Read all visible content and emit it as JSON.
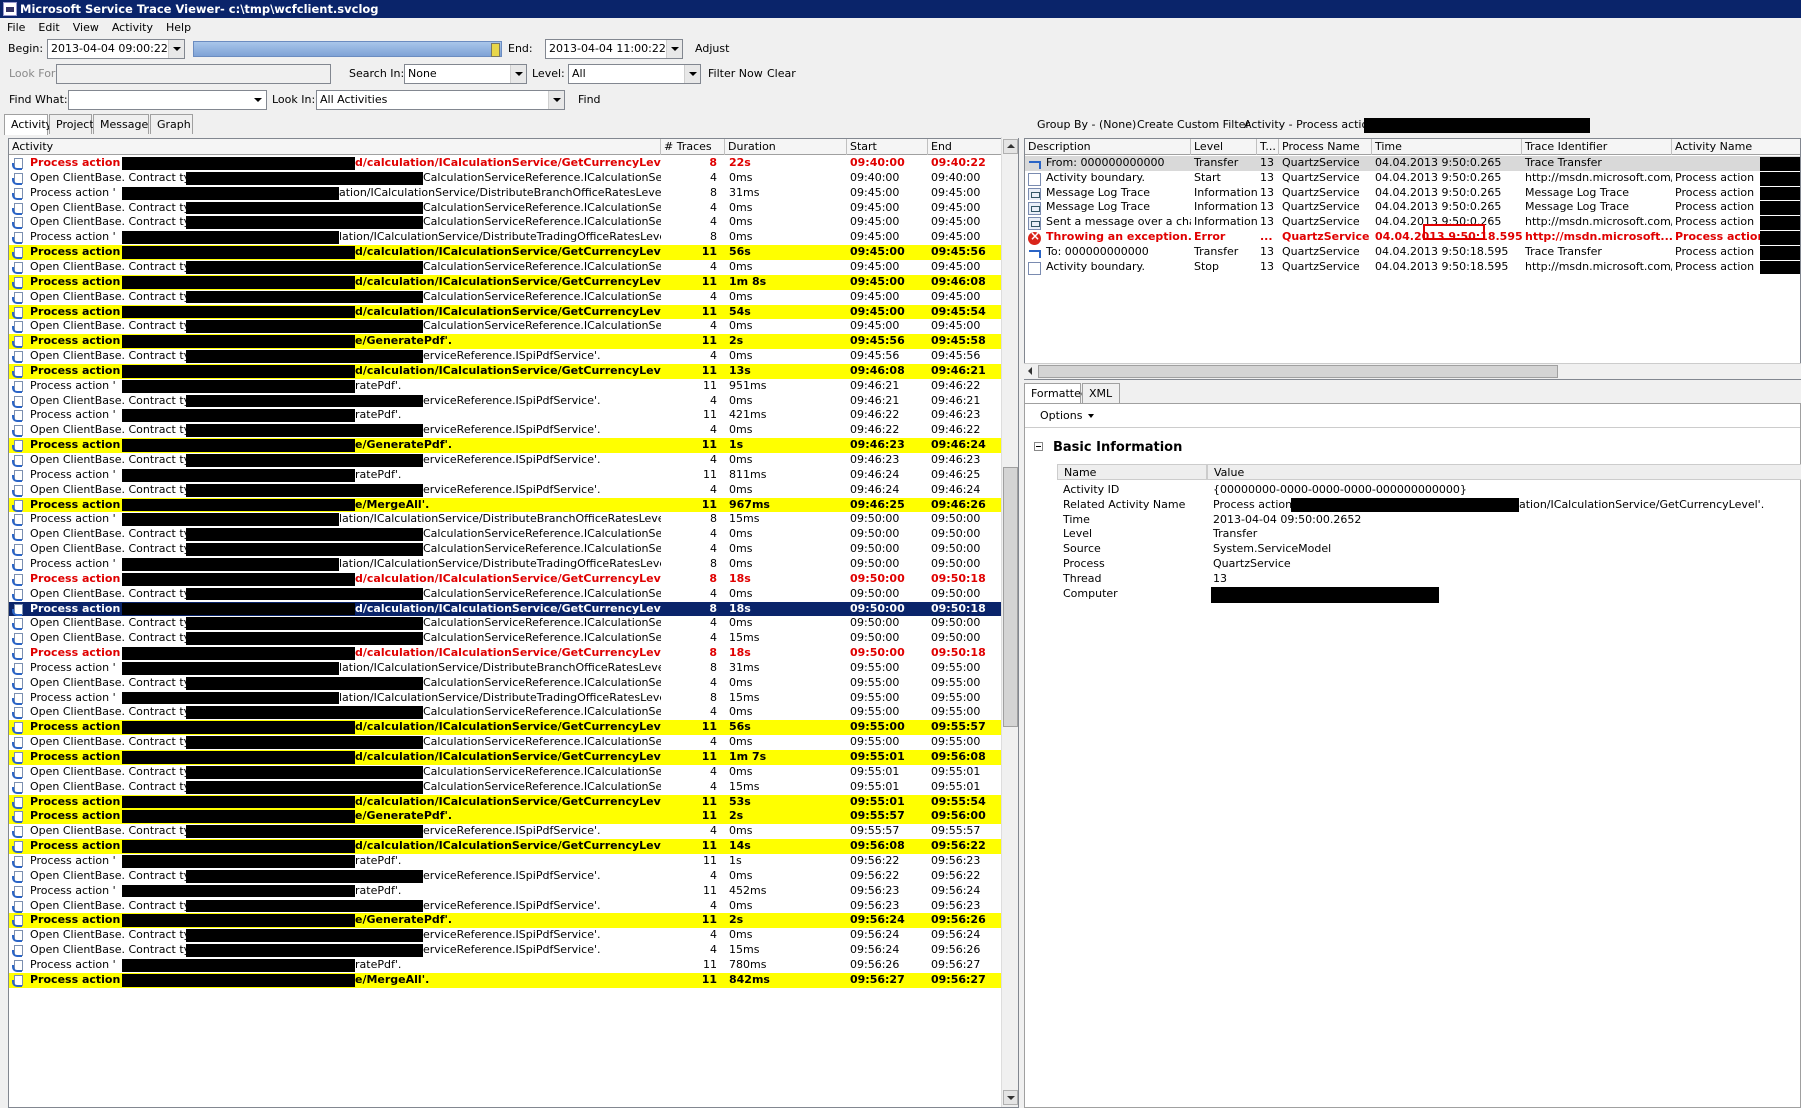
{
  "window": {
    "title": "Microsoft Service Trace Viewer- c:\\tmp\\wcfclient.svclog"
  },
  "menu": [
    "File",
    "Edit",
    "View",
    "Activity",
    "Help"
  ],
  "toolbar1": {
    "begin_label": "Begin:",
    "begin_value": "2013-04-04  09:00:22",
    "end_label": "End:",
    "end_value": "2013-04-04  11:00:22",
    "adjust_label": "Adjust"
  },
  "toolbar2": {
    "look_for_label": "Look For",
    "search_in_label": "Search In:",
    "search_in_value": "None",
    "level_label": "Level:",
    "level_value": "All",
    "filter_now_label": "Filter Now",
    "clear_label": "Clear"
  },
  "toolbar3": {
    "find_what_label": "Find What:",
    "look_in_label": "Look In:",
    "look_in_value": "All Activities",
    "find_label": "Find"
  },
  "left_tabs": [
    "Activity",
    "Project",
    "Message",
    "Graph"
  ],
  "right_toolbar": {
    "group_by": "Group By - (None)",
    "custom_filter": "Create Custom Filter",
    "activity_prefix": "Activity - Process action"
  },
  "activity_columns": [
    "Activity",
    "# Traces",
    "Duration",
    "Start",
    "End"
  ],
  "activities": [
    {
      "style": "r",
      "label": "Process action '",
      "suffix": "d/calculation/ICalculationService/GetCurrencyLevel'.",
      "traces": "8",
      "duration": "22s",
      "start": "09:40:00",
      "end": "09:40:22"
    },
    {
      "style": "n",
      "label": "Open ClientBase. Contract type: '",
      "suffix": "CalculationServiceReference.ICalculationService'.",
      "traces": "4",
      "duration": "0ms",
      "start": "09:40:00",
      "end": "09:40:00"
    },
    {
      "style": "n",
      "label": "Process action '",
      "suffix": "ation/ICalculationService/DistributeBranchOfficeRatesLevels'.",
      "traces": "8",
      "duration": "31ms",
      "start": "09:45:00",
      "end": "09:45:00"
    },
    {
      "style": "n",
      "label": "Open ClientBase. Contract type: '",
      "suffix": "CalculationServiceReference.ICalculationService'.",
      "traces": "4",
      "duration": "0ms",
      "start": "09:45:00",
      "end": "09:45:00"
    },
    {
      "style": "n",
      "label": "Open ClientBase. Contract type: '",
      "suffix": "CalculationServiceReference.ICalculationService'.",
      "traces": "4",
      "duration": "0ms",
      "start": "09:45:00",
      "end": "09:45:00"
    },
    {
      "style": "n",
      "label": "Process action '",
      "suffix": "lation/ICalculationService/DistributeTradingOfficeRatesLevels'.",
      "traces": "8",
      "duration": "0ms",
      "start": "09:45:00",
      "end": "09:45:00"
    },
    {
      "style": "y",
      "label": "Process action '",
      "suffix": "d/calculation/ICalculationService/GetCurrencyLevel'.",
      "traces": "11",
      "duration": "56s",
      "start": "09:45:00",
      "end": "09:45:56"
    },
    {
      "style": "n",
      "label": "Open ClientBase. Contract type: '",
      "suffix": "CalculationServiceReference.ICalculationService'.",
      "traces": "4",
      "duration": "0ms",
      "start": "09:45:00",
      "end": "09:45:00"
    },
    {
      "style": "y",
      "label": "Process action '",
      "suffix": "d/calculation/ICalculationService/GetCurrencyLevel'.",
      "traces": "11",
      "duration": "1m 8s",
      "start": "09:45:00",
      "end": "09:46:08"
    },
    {
      "style": "n",
      "label": "Open ClientBase. Contract type: '",
      "suffix": "CalculationServiceReference.ICalculationService'.",
      "traces": "4",
      "duration": "0ms",
      "start": "09:45:00",
      "end": "09:45:00"
    },
    {
      "style": "y",
      "label": "Process action '",
      "suffix": "d/calculation/ICalculationService/GetCurrencyLevel'.",
      "traces": "11",
      "duration": "54s",
      "start": "09:45:00",
      "end": "09:45:54"
    },
    {
      "style": "n",
      "label": "Open ClientBase. Contract type: '",
      "suffix": "CalculationServiceReference.ICalculationService'.",
      "traces": "4",
      "duration": "0ms",
      "start": "09:45:00",
      "end": "09:45:00"
    },
    {
      "style": "y",
      "label": "Process action '",
      "suffix": "e/GeneratePdf'.",
      "traces": "11",
      "duration": "2s",
      "start": "09:45:56",
      "end": "09:45:58"
    },
    {
      "style": "n",
      "label": "Open ClientBase. Contract type: '",
      "suffix": "erviceReference.ISpiPdfService'.",
      "traces": "4",
      "duration": "0ms",
      "start": "09:45:56",
      "end": "09:45:56"
    },
    {
      "style": "y",
      "label": "Process action '",
      "suffix": "d/calculation/ICalculationService/GetCurrencyLevel'.",
      "traces": "11",
      "duration": "13s",
      "start": "09:46:08",
      "end": "09:46:21"
    },
    {
      "style": "n",
      "label": "Process action '",
      "suffix": "ratePdf'.",
      "traces": "11",
      "duration": "951ms",
      "start": "09:46:21",
      "end": "09:46:22"
    },
    {
      "style": "n",
      "label": "Open ClientBase. Contract type: '",
      "suffix": "erviceReference.ISpiPdfService'.",
      "traces": "4",
      "duration": "0ms",
      "start": "09:46:21",
      "end": "09:46:21"
    },
    {
      "style": "n",
      "label": "Process action '",
      "suffix": "ratePdf'.",
      "traces": "11",
      "duration": "421ms",
      "start": "09:46:22",
      "end": "09:46:23"
    },
    {
      "style": "n",
      "label": "Open ClientBase. Contract type: '",
      "suffix": "erviceReference.ISpiPdfService'.",
      "traces": "4",
      "duration": "0ms",
      "start": "09:46:22",
      "end": "09:46:22"
    },
    {
      "style": "y",
      "label": "Process action '",
      "suffix": "e/GeneratePdf'.",
      "traces": "11",
      "duration": "1s",
      "start": "09:46:23",
      "end": "09:46:24"
    },
    {
      "style": "n",
      "label": "Open ClientBase. Contract type: '",
      "suffix": "erviceReference.ISpiPdfService'.",
      "traces": "4",
      "duration": "0ms",
      "start": "09:46:23",
      "end": "09:46:23"
    },
    {
      "style": "n",
      "label": "Process action '",
      "suffix": "ratePdf'.",
      "traces": "11",
      "duration": "811ms",
      "start": "09:46:24",
      "end": "09:46:25"
    },
    {
      "style": "n",
      "label": "Open ClientBase. Contract type: '",
      "suffix": "erviceReference.ISpiPdfService'.",
      "traces": "4",
      "duration": "0ms",
      "start": "09:46:24",
      "end": "09:46:24"
    },
    {
      "style": "y",
      "label": "Process action '",
      "suffix": "e/MergeAll'.",
      "traces": "11",
      "duration": "967ms",
      "start": "09:46:25",
      "end": "09:46:26"
    },
    {
      "style": "n",
      "label": "Process action '",
      "suffix": "lation/ICalculationService/DistributeBranchOfficeRatesLevels'.",
      "traces": "8",
      "duration": "15ms",
      "start": "09:50:00",
      "end": "09:50:00"
    },
    {
      "style": "n",
      "label": "Open ClientBase. Contract type: '",
      "suffix": "CalculationServiceReference.ICalculationService'.",
      "traces": "4",
      "duration": "0ms",
      "start": "09:50:00",
      "end": "09:50:00"
    },
    {
      "style": "n",
      "label": "Open ClientBase. Contract type: '",
      "suffix": "CalculationServiceReference.ICalculationService'.",
      "traces": "4",
      "duration": "0ms",
      "start": "09:50:00",
      "end": "09:50:00"
    },
    {
      "style": "n",
      "label": "Process action '",
      "suffix": "lation/ICalculationService/DistributeTradingOfficeRatesLevels'.",
      "traces": "8",
      "duration": "0ms",
      "start": "09:50:00",
      "end": "09:50:00"
    },
    {
      "style": "r",
      "label": "Process action '",
      "suffix": "d/calculation/ICalculationService/GetCurrencyLevel'.",
      "traces": "8",
      "duration": "18s",
      "start": "09:50:00",
      "end": "09:50:18"
    },
    {
      "style": "n",
      "label": "Open ClientBase. Contract type: '",
      "suffix": "CalculationServiceReference.ICalculationService'.",
      "traces": "4",
      "duration": "0ms",
      "start": "09:50:00",
      "end": "09:50:00"
    },
    {
      "style": "s",
      "label": "Process action '",
      "suffix": "d/calculation/ICalculationService/GetCurrencyLevel'.",
      "traces": "8",
      "duration": "18s",
      "start": "09:50:00",
      "end": "09:50:18"
    },
    {
      "style": "n",
      "label": "Open ClientBase. Contract type: '",
      "suffix": "CalculationServiceReference.ICalculationService'.",
      "traces": "4",
      "duration": "0ms",
      "start": "09:50:00",
      "end": "09:50:00"
    },
    {
      "style": "n",
      "label": "Open ClientBase. Contract type: '",
      "suffix": "CalculationServiceReference.ICalculationService'.",
      "traces": "4",
      "duration": "15ms",
      "start": "09:50:00",
      "end": "09:50:00"
    },
    {
      "style": "r",
      "label": "Process action '",
      "suffix": "d/calculation/ICalculationService/GetCurrencyLevel'.",
      "traces": "8",
      "duration": "18s",
      "start": "09:50:00",
      "end": "09:50:18"
    },
    {
      "style": "n",
      "label": "Process action '",
      "suffix": "lation/ICalculationService/DistributeBranchOfficeRatesLevels'.",
      "traces": "8",
      "duration": "31ms",
      "start": "09:55:00",
      "end": "09:55:00"
    },
    {
      "style": "n",
      "label": "Open ClientBase. Contract type: '",
      "suffix": "CalculationServiceReference.ICalculationService'.",
      "traces": "4",
      "duration": "0ms",
      "start": "09:55:00",
      "end": "09:55:00"
    },
    {
      "style": "n",
      "label": "Process action '",
      "suffix": "lation/ICalculationService/DistributeTradingOfficeRatesLevels'.",
      "traces": "8",
      "duration": "15ms",
      "start": "09:55:00",
      "end": "09:55:00"
    },
    {
      "style": "n",
      "label": "Open ClientBase. Contract type: '",
      "suffix": "CalculationServiceReference.ICalculationService'.",
      "traces": "4",
      "duration": "0ms",
      "start": "09:55:00",
      "end": "09:55:00"
    },
    {
      "style": "y",
      "label": "Process action '",
      "suffix": "d/calculation/ICalculationService/GetCurrencyLevel'.",
      "traces": "11",
      "duration": "56s",
      "start": "09:55:00",
      "end": "09:55:57"
    },
    {
      "style": "n",
      "label": "Open ClientBase. Contract type: '",
      "suffix": "CalculationServiceReference.ICalculationService'.",
      "traces": "4",
      "duration": "0ms",
      "start": "09:55:00",
      "end": "09:55:00"
    },
    {
      "style": "y",
      "label": "Process action '",
      "suffix": "d/calculation/ICalculationService/GetCurrencyLevel'.",
      "traces": "11",
      "duration": "1m 7s",
      "start": "09:55:01",
      "end": "09:56:08"
    },
    {
      "style": "n",
      "label": "Open ClientBase. Contract type: '",
      "suffix": "CalculationServiceReference.ICalculationService'.",
      "traces": "4",
      "duration": "0ms",
      "start": "09:55:01",
      "end": "09:55:01"
    },
    {
      "style": "n",
      "label": "Open ClientBase. Contract type: '",
      "suffix": "CalculationServiceReference.ICalculationService'.",
      "traces": "4",
      "duration": "15ms",
      "start": "09:55:01",
      "end": "09:55:01"
    },
    {
      "style": "y",
      "label": "Process action '",
      "suffix": "d/calculation/ICalculationService/GetCurrencyLevel'.",
      "traces": "11",
      "duration": "53s",
      "start": "09:55:01",
      "end": "09:55:54"
    },
    {
      "style": "y",
      "label": "Process action '",
      "suffix": "e/GeneratePdf'.",
      "traces": "11",
      "duration": "2s",
      "start": "09:55:57",
      "end": "09:56:00"
    },
    {
      "style": "n",
      "label": "Open ClientBase. Contract type: '",
      "suffix": "erviceReference.ISpiPdfService'.",
      "traces": "4",
      "duration": "0ms",
      "start": "09:55:57",
      "end": "09:55:57"
    },
    {
      "style": "y",
      "label": "Process action '",
      "suffix": "d/calculation/ICalculationService/GetCurrencyLevel'.",
      "traces": "11",
      "duration": "14s",
      "start": "09:56:08",
      "end": "09:56:22"
    },
    {
      "style": "n",
      "label": "Process action '",
      "suffix": "ratePdf'.",
      "traces": "11",
      "duration": "1s",
      "start": "09:56:22",
      "end": "09:56:23"
    },
    {
      "style": "n",
      "label": "Open ClientBase. Contract type: '",
      "suffix": "erviceReference.ISpiPdfService'.",
      "traces": "4",
      "duration": "0ms",
      "start": "09:56:22",
      "end": "09:56:22"
    },
    {
      "style": "n",
      "label": "Process action '",
      "suffix": "ratePdf'.",
      "traces": "11",
      "duration": "452ms",
      "start": "09:56:23",
      "end": "09:56:24"
    },
    {
      "style": "n",
      "label": "Open ClientBase. Contract type: '",
      "suffix": "erviceReference.ISpiPdfService'.",
      "traces": "4",
      "duration": "0ms",
      "start": "09:56:23",
      "end": "09:56:23"
    },
    {
      "style": "y",
      "label": "Process action '",
      "suffix": "e/GeneratePdf'.",
      "traces": "11",
      "duration": "2s",
      "start": "09:56:24",
      "end": "09:56:26"
    },
    {
      "style": "n",
      "label": "Open ClientBase. Contract type: '",
      "suffix": "erviceReference.ISpiPdfService'.",
      "traces": "4",
      "duration": "0ms",
      "start": "09:56:24",
      "end": "09:56:24"
    },
    {
      "style": "n",
      "label": "Open ClientBase. Contract type: '",
      "suffix": "erviceReference.ISpiPdfService'.",
      "traces": "4",
      "duration": "15ms",
      "start": "09:56:24",
      "end": "09:56:26"
    },
    {
      "style": "n",
      "label": "Process action '",
      "suffix": "ratePdf'.",
      "traces": "11",
      "duration": "780ms",
      "start": "09:56:26",
      "end": "09:56:27"
    },
    {
      "style": "y",
      "label": "Process action '",
      "suffix": "e/MergeAll'.",
      "traces": "11",
      "duration": "842ms",
      "start": "09:56:27",
      "end": "09:56:27"
    }
  ],
  "trace_columns": [
    "Description",
    "Level",
    "T...",
    "Process Name",
    "Time",
    "Trace Identifier",
    "Activity Name"
  ],
  "traces": [
    {
      "icon": "xfer",
      "style": "sel",
      "description": "From: 000000000000",
      "level": "Transfer",
      "thread": "13",
      "process": "QuartzService",
      "time": "04.04.2013  9:50:0.265",
      "identifier": "Trace Transfer",
      "activity": ""
    },
    {
      "icon": "bnd",
      "style": "n",
      "description": "Activity boundary.",
      "level": "Start",
      "thread": "13",
      "process": "QuartzService",
      "time": "04.04.2013  9:50:0.265",
      "identifier": "http://msdn.microsoft.com/...",
      "activity": "Process action"
    },
    {
      "icon": "msg",
      "style": "n",
      "description": "Message Log Trace",
      "level": "Information",
      "thread": "13",
      "process": "QuartzService",
      "time": "04.04.2013  9:50:0.265",
      "identifier": "Message Log Trace",
      "activity": "Process action"
    },
    {
      "icon": "msg",
      "style": "n",
      "description": "Message Log Trace",
      "level": "Information",
      "thread": "13",
      "process": "QuartzService",
      "time": "04.04.2013  9:50:0.265",
      "identifier": "Message Log Trace",
      "activity": "Process action"
    },
    {
      "icon": "msg",
      "style": "n",
      "description": "Sent a message over a cha...",
      "level": "Information",
      "thread": "13",
      "process": "QuartzService",
      "time": "04.04.2013  9:50:0.265",
      "identifier": "http://msdn.microsoft.com/...",
      "activity": "Process action"
    },
    {
      "icon": "err",
      "style": "err",
      "description": "Throwing an exception.",
      "level": "Error",
      "thread": "...",
      "process": "QuartzService",
      "time": "04.04.2013  9:50:18.595",
      "identifier": "http://msdn.microsoft....",
      "activity": "Process action '"
    },
    {
      "icon": "xfer",
      "style": "n",
      "description": "To: 000000000000",
      "level": "Transfer",
      "thread": "13",
      "process": "QuartzService",
      "time": "04.04.2013  9:50:18.595",
      "identifier": "Trace Transfer",
      "activity": "Process action"
    },
    {
      "icon": "bnd",
      "style": "n",
      "description": "Activity boundary.",
      "level": "Stop",
      "thread": "13",
      "process": "QuartzService",
      "time": "04.04.2013  9:50:18.595",
      "identifier": "http://msdn.microsoft.com/...",
      "activity": "Process action"
    }
  ],
  "detail_tabs": [
    "Formatted",
    "XML"
  ],
  "options_label": "Options",
  "basic_info": {
    "title": "Basic Information",
    "col_name": "Name",
    "col_value": "Value",
    "rows": [
      {
        "name": "Activity ID",
        "value": "{00000000-0000-0000-0000-000000000000}"
      },
      {
        "name": "Related Activity Name",
        "value": "Process action '",
        "suffix": "ation/ICalculationService/GetCurrencyLevel'."
      },
      {
        "name": "Time",
        "value": "2013-04-04 09:50:00.2652"
      },
      {
        "name": "Level",
        "value": "Transfer"
      },
      {
        "name": "Source",
        "value": "System.ServiceModel"
      },
      {
        "name": "Process",
        "value": "QuartzService"
      },
      {
        "name": "Thread",
        "value": "13"
      },
      {
        "name": "Computer",
        "value": ""
      }
    ]
  },
  "colors": {
    "highlight_yellow": "#ffff00",
    "error_red": "#e00000",
    "selection": "#0a246a",
    "title_bar": "#0a246a"
  }
}
